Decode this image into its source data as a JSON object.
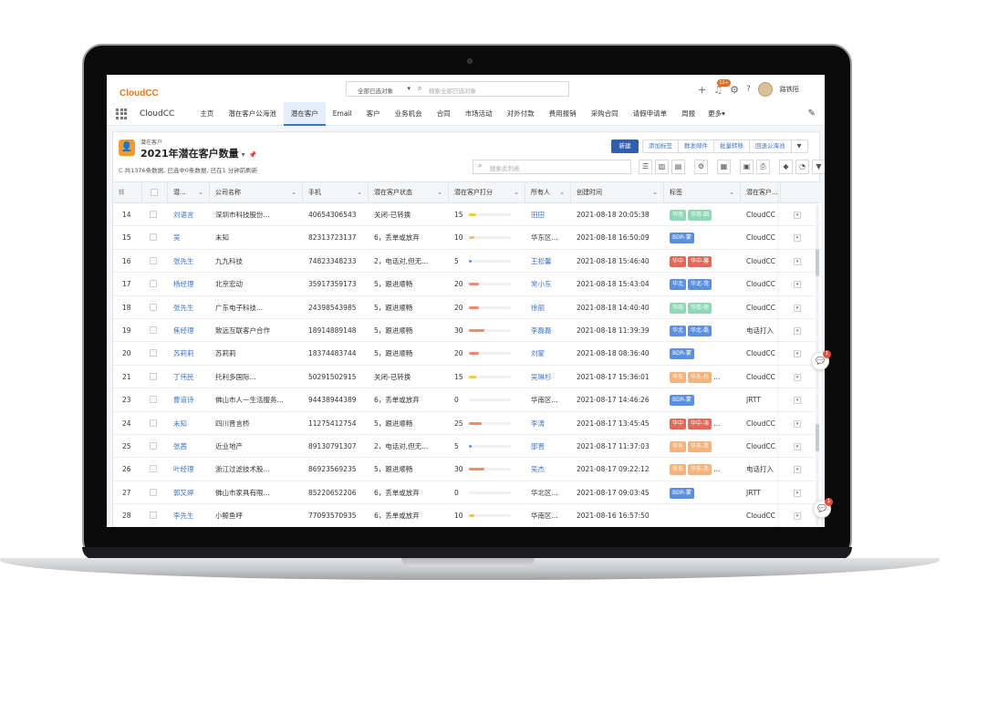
{
  "topbar": {
    "logo": "CloudCC",
    "search_scope": "全部已选对象",
    "search_placeholder": "搜索全部已选对象",
    "notification_badge": "12+",
    "user_name": "路铁阳"
  },
  "nav": {
    "app_name": "CloudCC",
    "tabs": [
      "主页",
      "潜在客户公海池",
      "潜在客户",
      "Email",
      "客户",
      "业务机会",
      "合同",
      "市场活动",
      "对外付款",
      "费用报销",
      "采购合同",
      "请假申请单",
      "周报"
    ],
    "active_tab": "潜在客户",
    "more": "更多▾"
  },
  "list": {
    "object_label": "潜在客户",
    "view_title": "2021年潜在客户数量",
    "meta": "共1376条数据, 已选中0条数据, 已在1 分钟前刷新",
    "new_button": "新建",
    "actions": [
      "添加标签",
      "群发邮件",
      "批量转移",
      "回退公海池",
      "▼"
    ],
    "search_placeholder": "搜索此列表"
  },
  "columns": [
    "潜...",
    "公司名称",
    "手机",
    "潜在客户状态",
    "潜在客户打分",
    "所有人",
    "创建时间",
    "标签",
    "潜在客户..."
  ],
  "rows": [
    {
      "no": "14",
      "name": "刘语言",
      "company": "深圳市科技股份...",
      "phone": "40654306543",
      "status": "关闭-已转换",
      "score": "15",
      "score_pct": 15,
      "owner": "田田",
      "owner_link": true,
      "created": "2021-08-18 20:05:38",
      "tags": [
        {
          "t": "华南",
          "c": "green"
        },
        {
          "t": "华南-田",
          "c": "green"
        }
      ],
      "tags_more": "",
      "source": "CloudCC"
    },
    {
      "no": "15",
      "name": "吴",
      "company": "未知",
      "phone": "82313723137",
      "status": "6，丢单或放弃",
      "score": "10",
      "score_pct": 10,
      "owner": "华东区...",
      "owner_link": false,
      "created": "2021-08-18 16:50:09",
      "tags": [
        {
          "t": "BDR-蒙",
          "c": "blue"
        }
      ],
      "tags_more": "",
      "source": "CloudCC"
    },
    {
      "no": "16",
      "name": "张先生",
      "company": "九九科技",
      "phone": "74823348233",
      "status": "2，电话对,但无...",
      "score": "5",
      "score_pct": 5,
      "owner": "王松馨",
      "owner_link": true,
      "created": "2021-08-18 15:46:40",
      "tags": [
        {
          "t": "华中",
          "c": "red"
        },
        {
          "t": "华中-馨",
          "c": "red"
        }
      ],
      "tags_more": "",
      "source": "CloudCC"
    },
    {
      "no": "17",
      "name": "杨经理",
      "company": "北京宏动",
      "phone": "35917359173",
      "status": "5，跟进顺畅",
      "score": "20",
      "score_pct": 20,
      "owner": "常小东",
      "owner_link": true,
      "created": "2021-08-18 15:43:04",
      "tags": [
        {
          "t": "华北",
          "c": "blue"
        },
        {
          "t": "华北-常",
          "c": "blue"
        }
      ],
      "tags_more": "",
      "source": "CloudCC"
    },
    {
      "no": "18",
      "name": "张先生",
      "company": "广东电子科技...",
      "phone": "24398543985",
      "status": "5，跟进顺畅",
      "score": "20",
      "score_pct": 20,
      "owner": "徐丽",
      "owner_link": true,
      "created": "2021-08-18 14:40:40",
      "tags": [
        {
          "t": "华南",
          "c": "green"
        },
        {
          "t": "华南-徐",
          "c": "green"
        }
      ],
      "tags_more": "",
      "source": "CloudCC"
    },
    {
      "no": "19",
      "name": "焦经理",
      "company": "致远互联客户合作",
      "phone": "18914889148",
      "status": "5，跟进顺畅",
      "score": "30",
      "score_pct": 30,
      "owner": "李磊磊",
      "owner_link": true,
      "created": "2021-08-18 11:39:39",
      "tags": [
        {
          "t": "华北",
          "c": "blue"
        },
        {
          "t": "华北-磊",
          "c": "blue"
        }
      ],
      "tags_more": "",
      "source": "电话打入"
    },
    {
      "no": "20",
      "name": "苏莉莉",
      "company": "苏莉莉",
      "phone": "18374483744",
      "status": "5，跟进顺畅",
      "score": "20",
      "score_pct": 20,
      "owner": "刘蒙",
      "owner_link": true,
      "created": "2021-08-18 08:36:40",
      "tags": [
        {
          "t": "BDR-蒙",
          "c": "blue"
        }
      ],
      "tags_more": "",
      "source": "CloudCC"
    },
    {
      "no": "21",
      "name": "丁伟民",
      "company": "托利多国际...",
      "phone": "50291502915",
      "status": "关闭-已转换",
      "score": "15",
      "score_pct": 15,
      "owner": "吴琳杉",
      "owner_link": true,
      "created": "2021-08-17 15:36:01",
      "tags": [
        {
          "t": "华东",
          "c": "orange"
        },
        {
          "t": "华东-杉",
          "c": "orange"
        }
      ],
      "tags_more": "...",
      "source": "CloudCC"
    },
    {
      "no": "23",
      "name": "曹道诗",
      "company": "佛山市人一生活服务...",
      "phone": "94438944389",
      "status": "6，丢单或放弃",
      "score": "0",
      "score_pct": 0,
      "owner": "华南区...",
      "owner_link": false,
      "created": "2021-08-17 14:46:26",
      "tags": [
        {
          "t": "BDR-蒙",
          "c": "blue"
        }
      ],
      "tags_more": "",
      "source": "JRTT"
    },
    {
      "no": "24",
      "name": "未知",
      "company": "四川晋言桥",
      "phone": "11275412754",
      "status": "5，跟进顺畅",
      "score": "25",
      "score_pct": 25,
      "owner": "李涛",
      "owner_link": true,
      "created": "2021-08-17 13:45:45",
      "tags": [
        {
          "t": "华中",
          "c": "red"
        },
        {
          "t": "华中-涛",
          "c": "red"
        }
      ],
      "tags_more": "...",
      "source": "CloudCC"
    },
    {
      "no": "25",
      "name": "张茜",
      "company": "近业地产",
      "phone": "89130791307",
      "status": "2，电话对,但无...",
      "score": "5",
      "score_pct": 5,
      "owner": "邵晋",
      "owner_link": true,
      "created": "2021-08-17 11:37:03",
      "tags": [
        {
          "t": "华东",
          "c": "orange"
        },
        {
          "t": "华东-晋",
          "c": "orange"
        }
      ],
      "tags_more": "",
      "source": "CloudCC"
    },
    {
      "no": "26",
      "name": "叶经理",
      "company": "浙江过滤技术股...",
      "phone": "86923569235",
      "status": "5，跟进顺畅",
      "score": "30",
      "score_pct": 30,
      "owner": "吴杰",
      "owner_link": true,
      "created": "2021-08-17 09:22:12",
      "tags": [
        {
          "t": "华东",
          "c": "orange"
        },
        {
          "t": "华东-杰",
          "c": "orange"
        }
      ],
      "tags_more": "...",
      "source": "电话打入"
    },
    {
      "no": "27",
      "name": "郭又婷",
      "company": "佛山市家具有限...",
      "phone": "85220652206",
      "status": "6，丢单或放弃",
      "score": "0",
      "score_pct": 0,
      "owner": "华北区...",
      "owner_link": false,
      "created": "2021-08-17 09:03:45",
      "tags": [
        {
          "t": "BDR-蒙",
          "c": "blue"
        }
      ],
      "tags_more": "",
      "source": "JRTT"
    },
    {
      "no": "28",
      "name": "李先生",
      "company": "小鲸鱼呼",
      "phone": "77093570935",
      "status": "6，丢单或放弃",
      "score": "10",
      "score_pct": 10,
      "owner": "华南区...",
      "owner_link": false,
      "created": "2021-08-16 16:57:50",
      "tags": [],
      "tags_more": "",
      "source": "CloudCC"
    }
  ],
  "chat": {
    "badge1": "1",
    "badge2": "1"
  },
  "colors": {
    "accent": "#2f5fae",
    "link": "#3b73c7",
    "logo": "#e07a12",
    "bar_low": "#f2c94c",
    "bar_mid": "#f08a6e",
    "bar_small": "#5b8fe0"
  }
}
